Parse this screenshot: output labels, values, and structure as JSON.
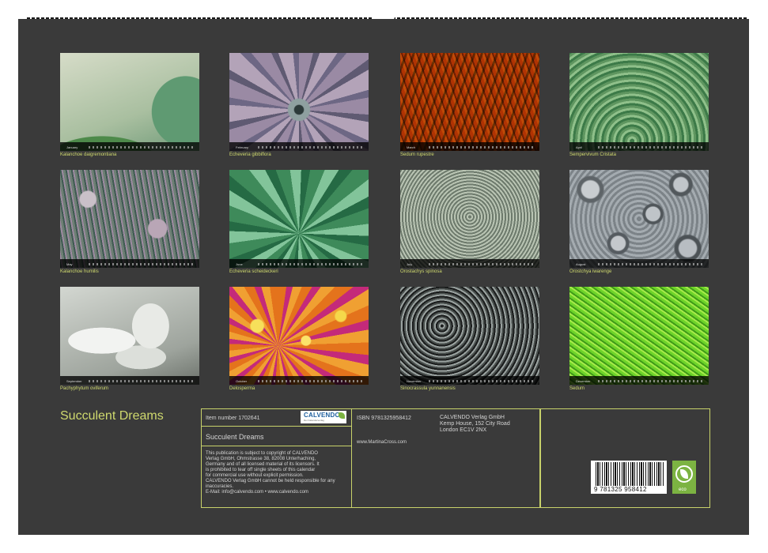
{
  "calendar": {
    "months": [
      {
        "month": "January",
        "caption": "Kalanchoe daigremontiana"
      },
      {
        "month": "February",
        "caption": "Echeveria gibbiflora"
      },
      {
        "month": "March",
        "caption": "Sedum rupestre"
      },
      {
        "month": "April",
        "caption": "Sempervivum Cristata"
      },
      {
        "month": "May",
        "caption": "Kalanchoe humilis"
      },
      {
        "month": "June",
        "caption": "Echeveria scheideckeri"
      },
      {
        "month": "July",
        "caption": "Orostachys spinosa"
      },
      {
        "month": "August",
        "caption": "Orostchya iwarenge"
      },
      {
        "month": "September",
        "caption": "Pachyphytum oviferum"
      },
      {
        "month": "October",
        "caption": "Delosperma"
      },
      {
        "month": "November",
        "caption": "Sinocrassula yunnanensis"
      },
      {
        "month": "December",
        "caption": "Sedum"
      }
    ]
  },
  "title": "Succulent Dreams",
  "info": {
    "item_number": "Item number 1702641",
    "product_title": "Succulent Dreams",
    "copyright_lines": [
      "This publication is subject to copyright of CALVENDO",
      "Verlag GmbH, Ohmstrasse 38, 82008 Unterhaching,",
      "Germany and of all licensed material of its licensors. It",
      "is prohibited to tear off single sheets of this calendar",
      "for commercial use without explicit permission.",
      "CALVENDO Verlag GmbH cannot be held responsible for any",
      "inaccuracies.",
      "E-Mail: info@calvendo.com • www.calvendo.com"
    ],
    "isbn": "ISBN 9781325958412",
    "website": "www.MartinaCross.com",
    "publisher_lines": [
      "CALVENDO Verlag GmbH",
      "Kemp House, 152 City Road",
      "London EC1V 2NX"
    ],
    "logo_text": "CALVENDO",
    "logo_tagline": "Der Kalenderverlag",
    "barcode_digits": "9 781325 958412",
    "eco_label": "eco"
  },
  "colors": {
    "background": "#3a3a3a",
    "accent": "#cfd96e",
    "eco_green": "#7cb342"
  }
}
